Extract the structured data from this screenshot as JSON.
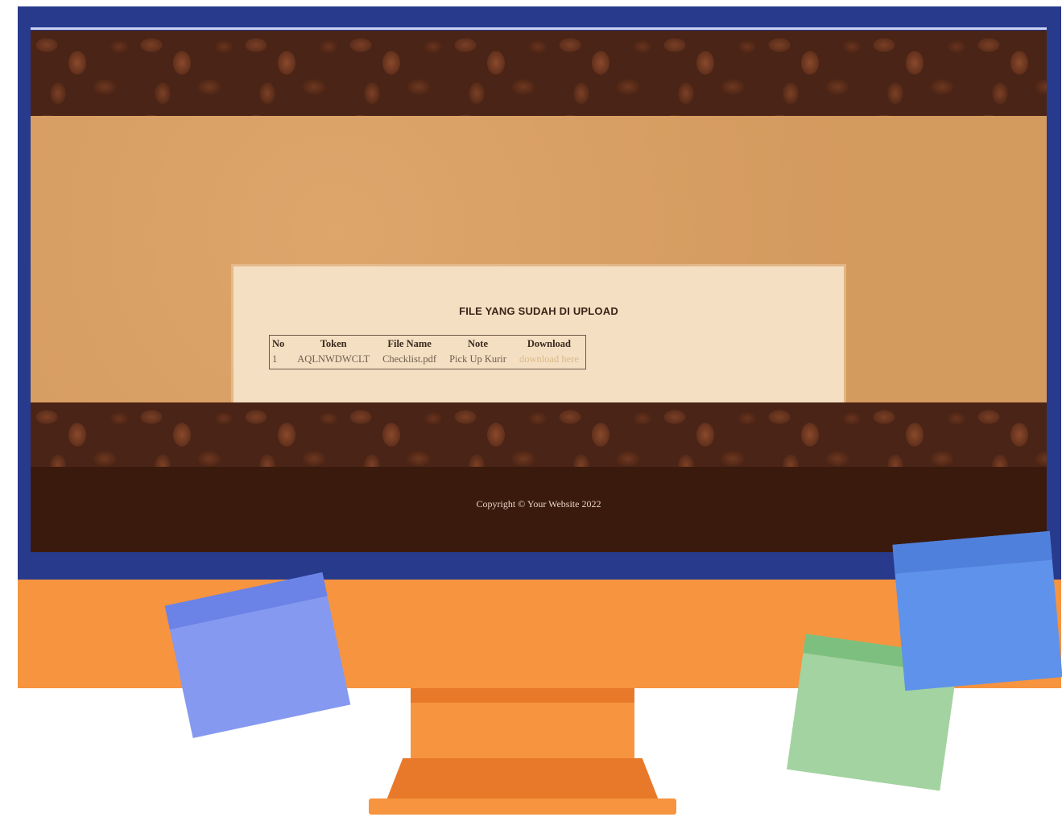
{
  "page": {
    "title": "FILE YANG SUDAH DI UPLOAD",
    "footer": "Copyright © Your Website 2022"
  },
  "table": {
    "headers": [
      "No",
      "Token",
      "File Name",
      "Note",
      "Download"
    ],
    "rows": [
      {
        "no": "1",
        "token": "AQLNWDWCLT",
        "file_name": "Checklist.pdf",
        "note": "Pick Up Kurir",
        "download": "download here"
      }
    ]
  },
  "colors": {
    "bezel": "#283a8c",
    "chin": "#f6943f",
    "band": "#dca062",
    "panel": "#f5dfc2",
    "footer": "#3b1a0e"
  }
}
